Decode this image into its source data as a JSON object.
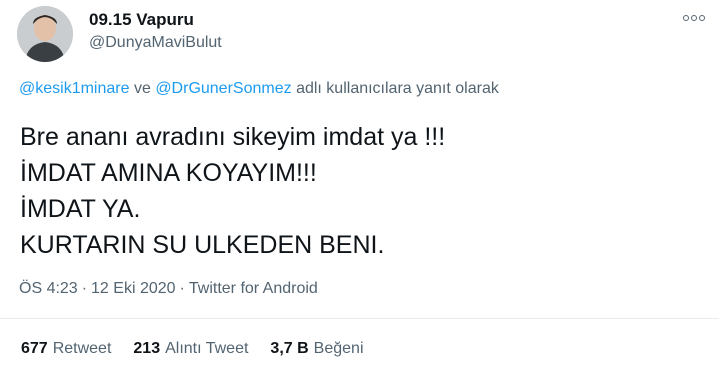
{
  "tweet": {
    "display_name": "09.15 Vapuru",
    "handle": "@DunyaMaviBulut",
    "reply_to": {
      "user1": "@kesik1minare",
      "conj": "ve",
      "user2": "@DrGunerSonmez",
      "suffix": "adlı kullanıcılara yanıt olarak"
    },
    "lines": [
      "Bre ananı avradını sikeyim imdat ya !!!",
      "İMDAT AMINA KOYAYIM!!!",
      "İMDAT YA.",
      "KURTARIN SU ULKEDEN BENI."
    ],
    "time": "ÖS 4:23",
    "date": "12 Eki 2020",
    "source": "Twitter for Android",
    "separator": "·",
    "stats": {
      "retweets": "677",
      "retweets_label": "Retweet",
      "quotes": "213",
      "quotes_label": "Alıntı Tweet",
      "likes": "3,7 B",
      "likes_label": "Beğeni"
    }
  },
  "icons": {
    "more": "more-horizontal-icon",
    "avatar": "avatar-photo"
  },
  "colors": {
    "text": "#0f1419",
    "secondary": "#536471",
    "link": "#1d9bf0",
    "divider": "#e6ecf0"
  }
}
